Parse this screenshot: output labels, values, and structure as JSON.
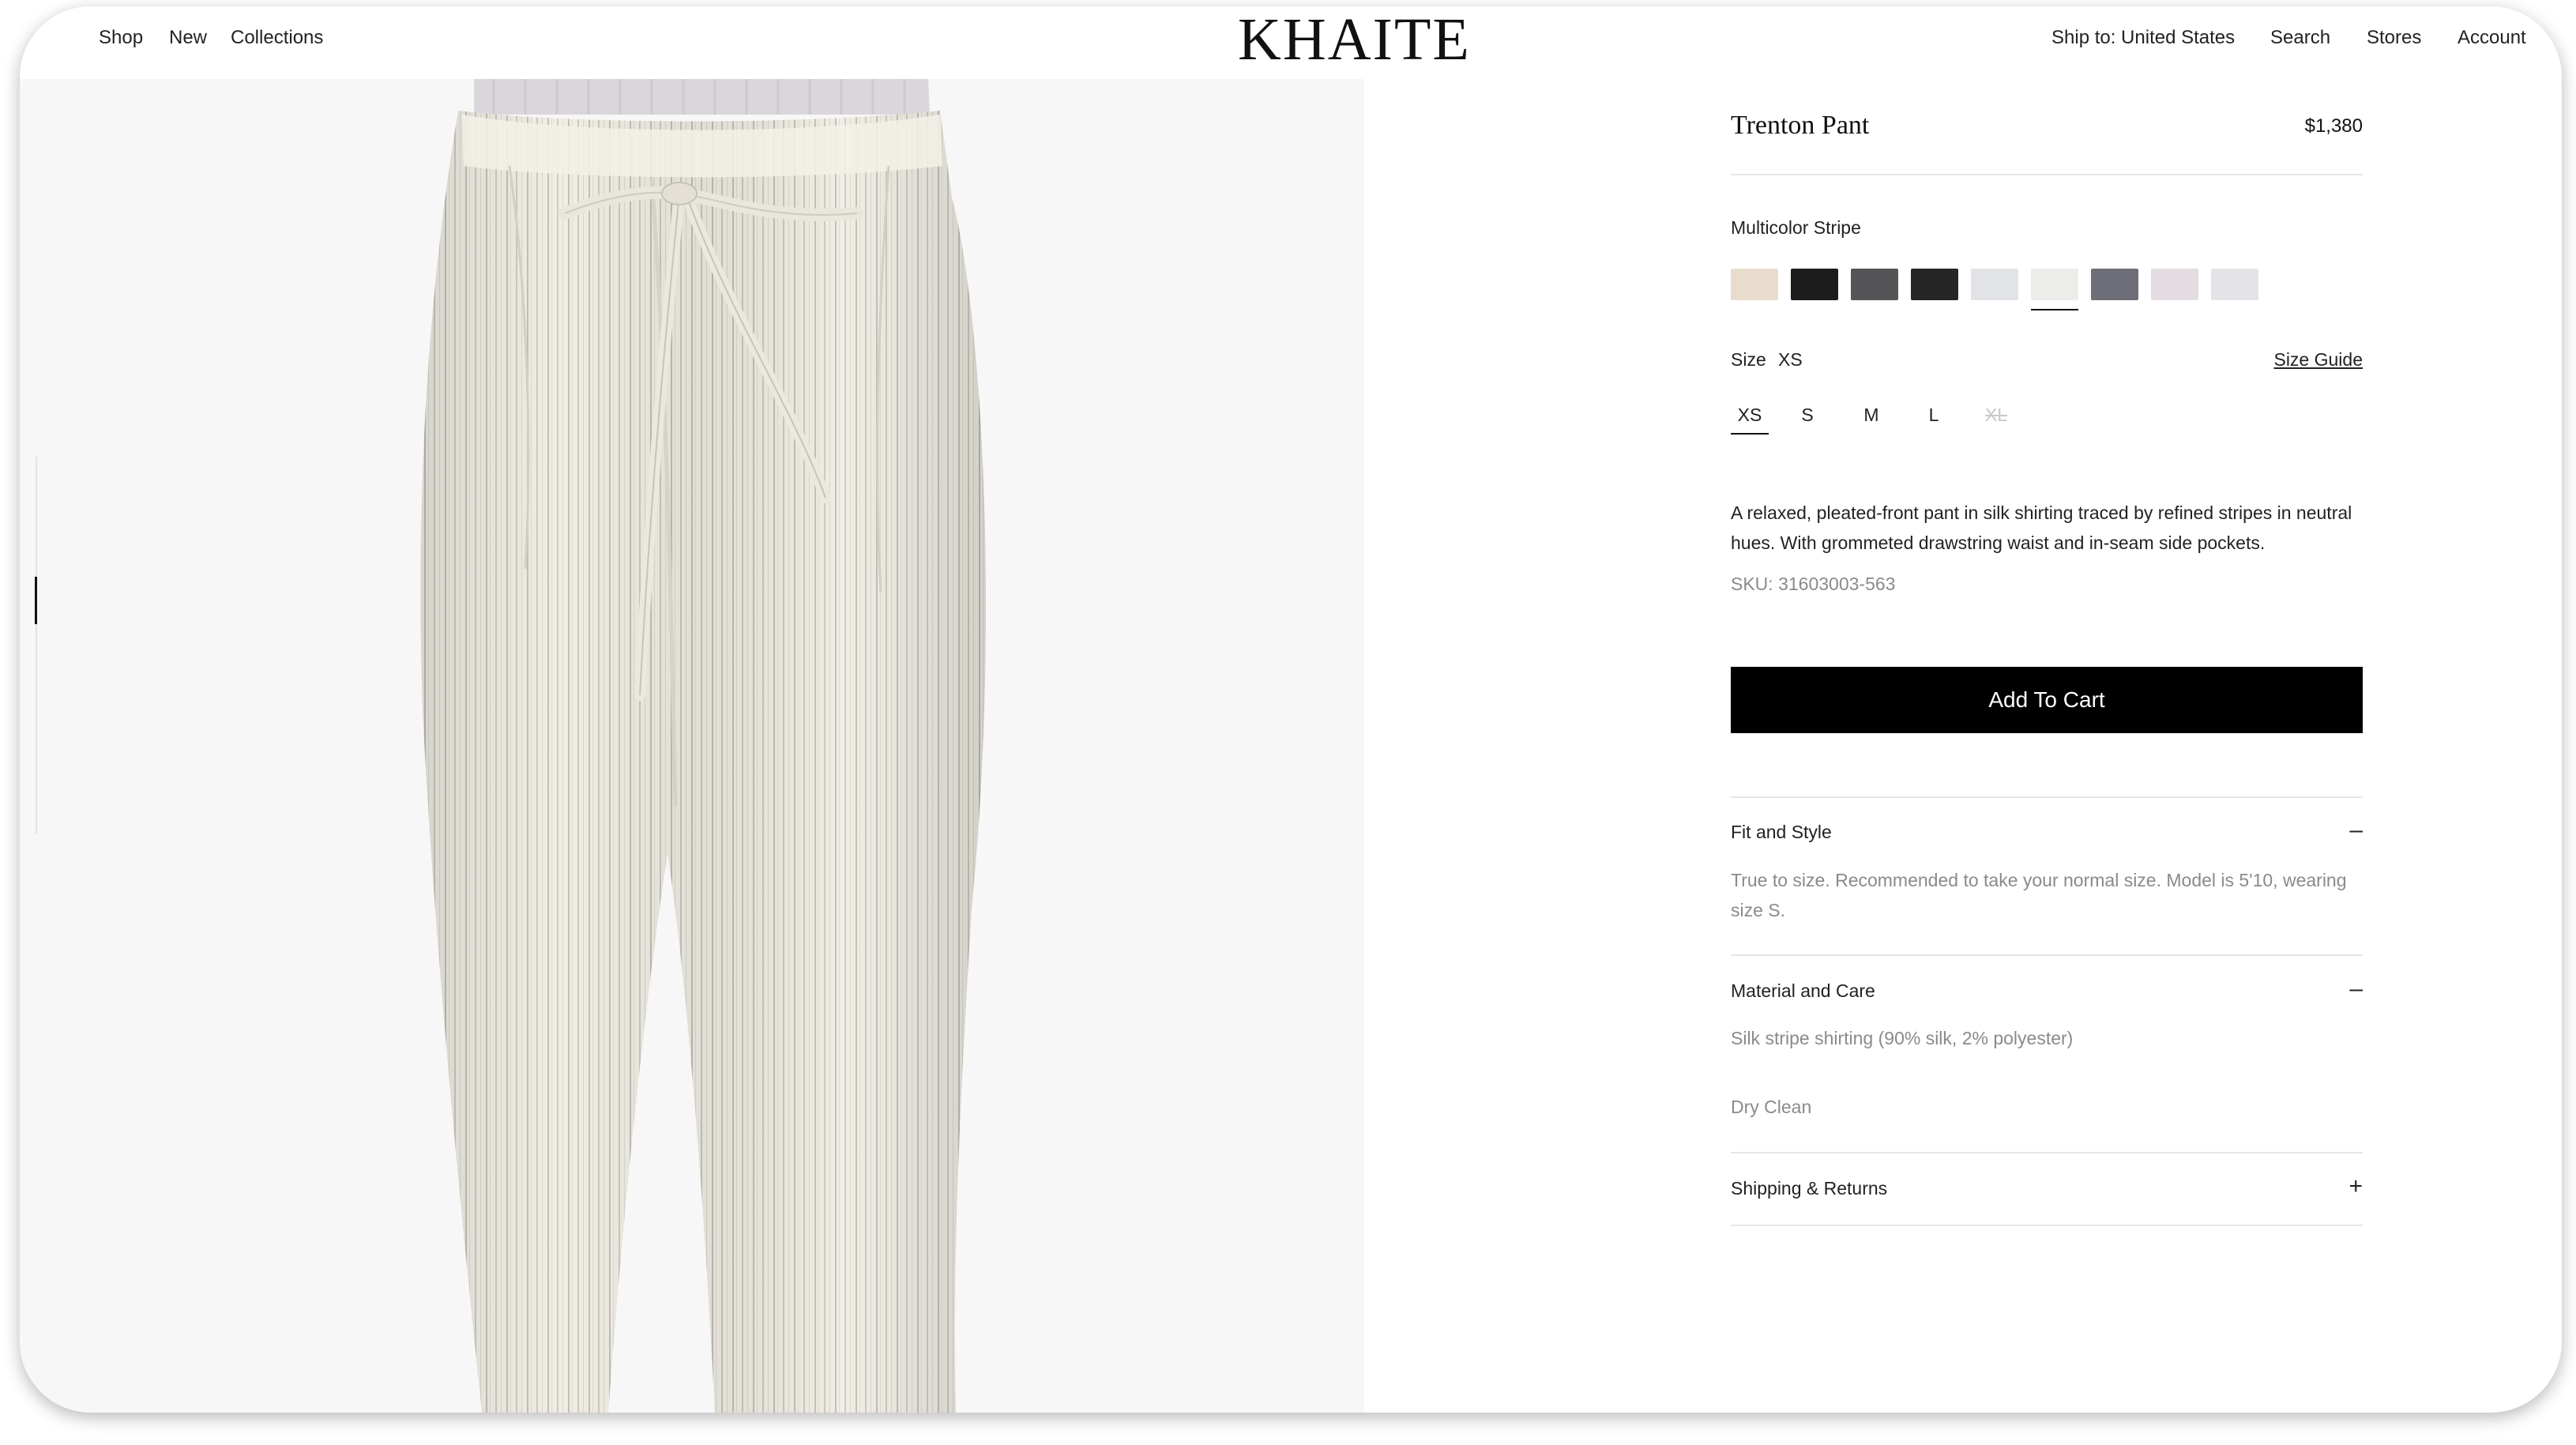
{
  "header": {
    "nav_left": [
      "Shop",
      "New",
      "Collections"
    ],
    "logo": "KHAITE",
    "nav_right": [
      "Ship to: United States",
      "Search",
      "Stores",
      "Account"
    ]
  },
  "product": {
    "title": "Trenton Pant",
    "price": "$1,380",
    "color_name": "Multicolor Stripe",
    "swatches": [
      "#e8dccd",
      "#1c1c1c",
      "#555557",
      "#262626",
      "#e2e3e6",
      "#ececea",
      "#6e6e78",
      "#e4dce2",
      "#e4e4e8"
    ],
    "selected_swatch_index": 5,
    "size_label": "Size",
    "size_selected": "XS",
    "size_guide": "Size Guide",
    "sizes": [
      "XS",
      "S",
      "M",
      "L",
      "XL"
    ],
    "unavailable_sizes": [
      "XL"
    ],
    "description": "A relaxed, pleated-front pant in silk shirting traced by refined stripes in neutral hues. With grommeted drawstring waist and in-seam side pockets.",
    "sku": "SKU: 31603003-563",
    "add_to_cart": "Add To Cart"
  },
  "accordion": [
    {
      "title": "Fit and Style",
      "icon": "minus-icon",
      "symbol": "–",
      "body": [
        "True to size. Recommended to take your normal size. Model is 5'10, wearing size S."
      ]
    },
    {
      "title": "Material and Care",
      "icon": "minus-icon",
      "symbol": "–",
      "body": [
        "Silk stripe shirting (90% silk, 2% polyester)",
        "Dry Clean"
      ]
    },
    {
      "title": "Shipping & Returns",
      "icon": "plus-icon",
      "symbol": "+",
      "body": []
    }
  ],
  "colors": {
    "accent": "#000000",
    "muted_text": "#8a8a8a",
    "image_bg": "#f7f7f7"
  }
}
